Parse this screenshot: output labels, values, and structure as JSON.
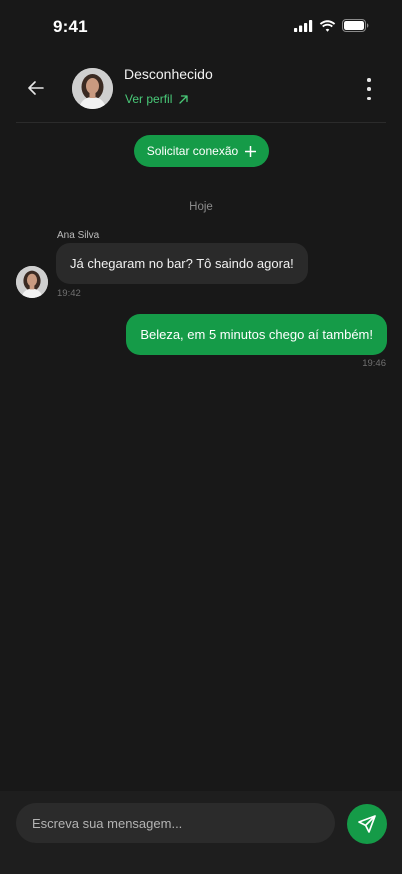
{
  "status_bar": {
    "time": "9:41"
  },
  "header": {
    "contact_name": "Desconhecido",
    "profile_link": "Ver perfil"
  },
  "connect_button": {
    "label": "Solicitar conexão"
  },
  "chat": {
    "date_label": "Hoje",
    "messages": [
      {
        "direction": "incoming",
        "sender": "Ana Silva",
        "text": "Já chegaram no bar? Tô saindo agora!",
        "time": "19:42"
      },
      {
        "direction": "outgoing",
        "text": "Beleza, em 5 minutos chego aí também!",
        "time": "19:46"
      }
    ]
  },
  "composer": {
    "placeholder": "Escreva sua mensagem..."
  },
  "colors": {
    "accent": "#159b48",
    "link": "#49c978",
    "background": "#181818",
    "bubble_in": "#2a2a2a"
  },
  "icons": [
    "signal-icon",
    "wifi-icon",
    "battery-icon",
    "back-arrow-icon",
    "external-link-icon",
    "more-vertical-icon",
    "plus-icon",
    "send-icon"
  ]
}
